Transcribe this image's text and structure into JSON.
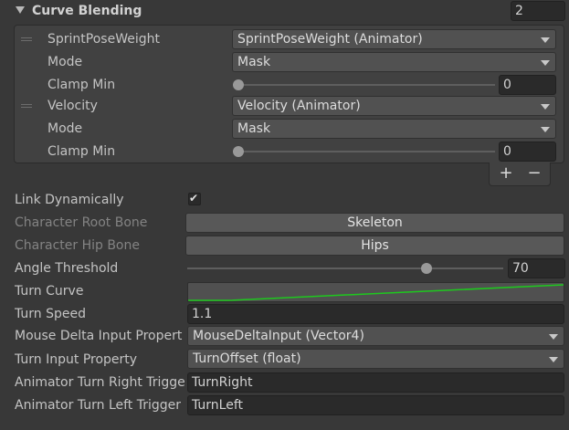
{
  "curve_blending": {
    "title": "Curve Blending",
    "count": "2",
    "items": [
      {
        "param_label": "SprintPoseWeight",
        "param_value": "SprintPoseWeight (Animator)",
        "mode_label": "Mode",
        "mode_value": "Mask",
        "clamp_label": "Clamp Min",
        "clamp_value": "0",
        "clamp_slider": 0
      },
      {
        "param_label": "Velocity",
        "param_value": "Velocity (Animator)",
        "mode_label": "Mode",
        "mode_value": "Mask",
        "clamp_label": "Clamp Min",
        "clamp_value": "0",
        "clamp_slider": 0
      }
    ],
    "add_label": "+",
    "remove_label": "−"
  },
  "link_dynamically": {
    "label": "Link Dynamically",
    "checked": true,
    "check_glyph": "✔"
  },
  "character_root_bone": {
    "label": "Character Root Bone",
    "value": "Skeleton"
  },
  "character_hip_bone": {
    "label": "Character Hip Bone",
    "value": "Hips"
  },
  "angle_threshold": {
    "label": "Angle Threshold",
    "value": "70",
    "slider_fraction": 0.7
  },
  "turn_curve": {
    "label": "Turn Curve",
    "curve_color": "#1ec81e"
  },
  "turn_speed": {
    "label": "Turn Speed",
    "value": "1.1"
  },
  "mouse_delta": {
    "label": "Mouse Delta Input Propert",
    "value": "MouseDeltaInput (Vector4)"
  },
  "turn_input": {
    "label": "Turn Input Property",
    "value": "TurnOffset (float)"
  },
  "turn_right": {
    "label": "Animator Turn Right Trigge",
    "value": "TurnRight"
  },
  "turn_left": {
    "label": "Animator Turn Left Trigger",
    "value": "TurnLeft"
  },
  "colors": {
    "background": "#383838",
    "field": "#2a2a2a",
    "dropdown": "#515151",
    "curve": "#1ec81e"
  }
}
